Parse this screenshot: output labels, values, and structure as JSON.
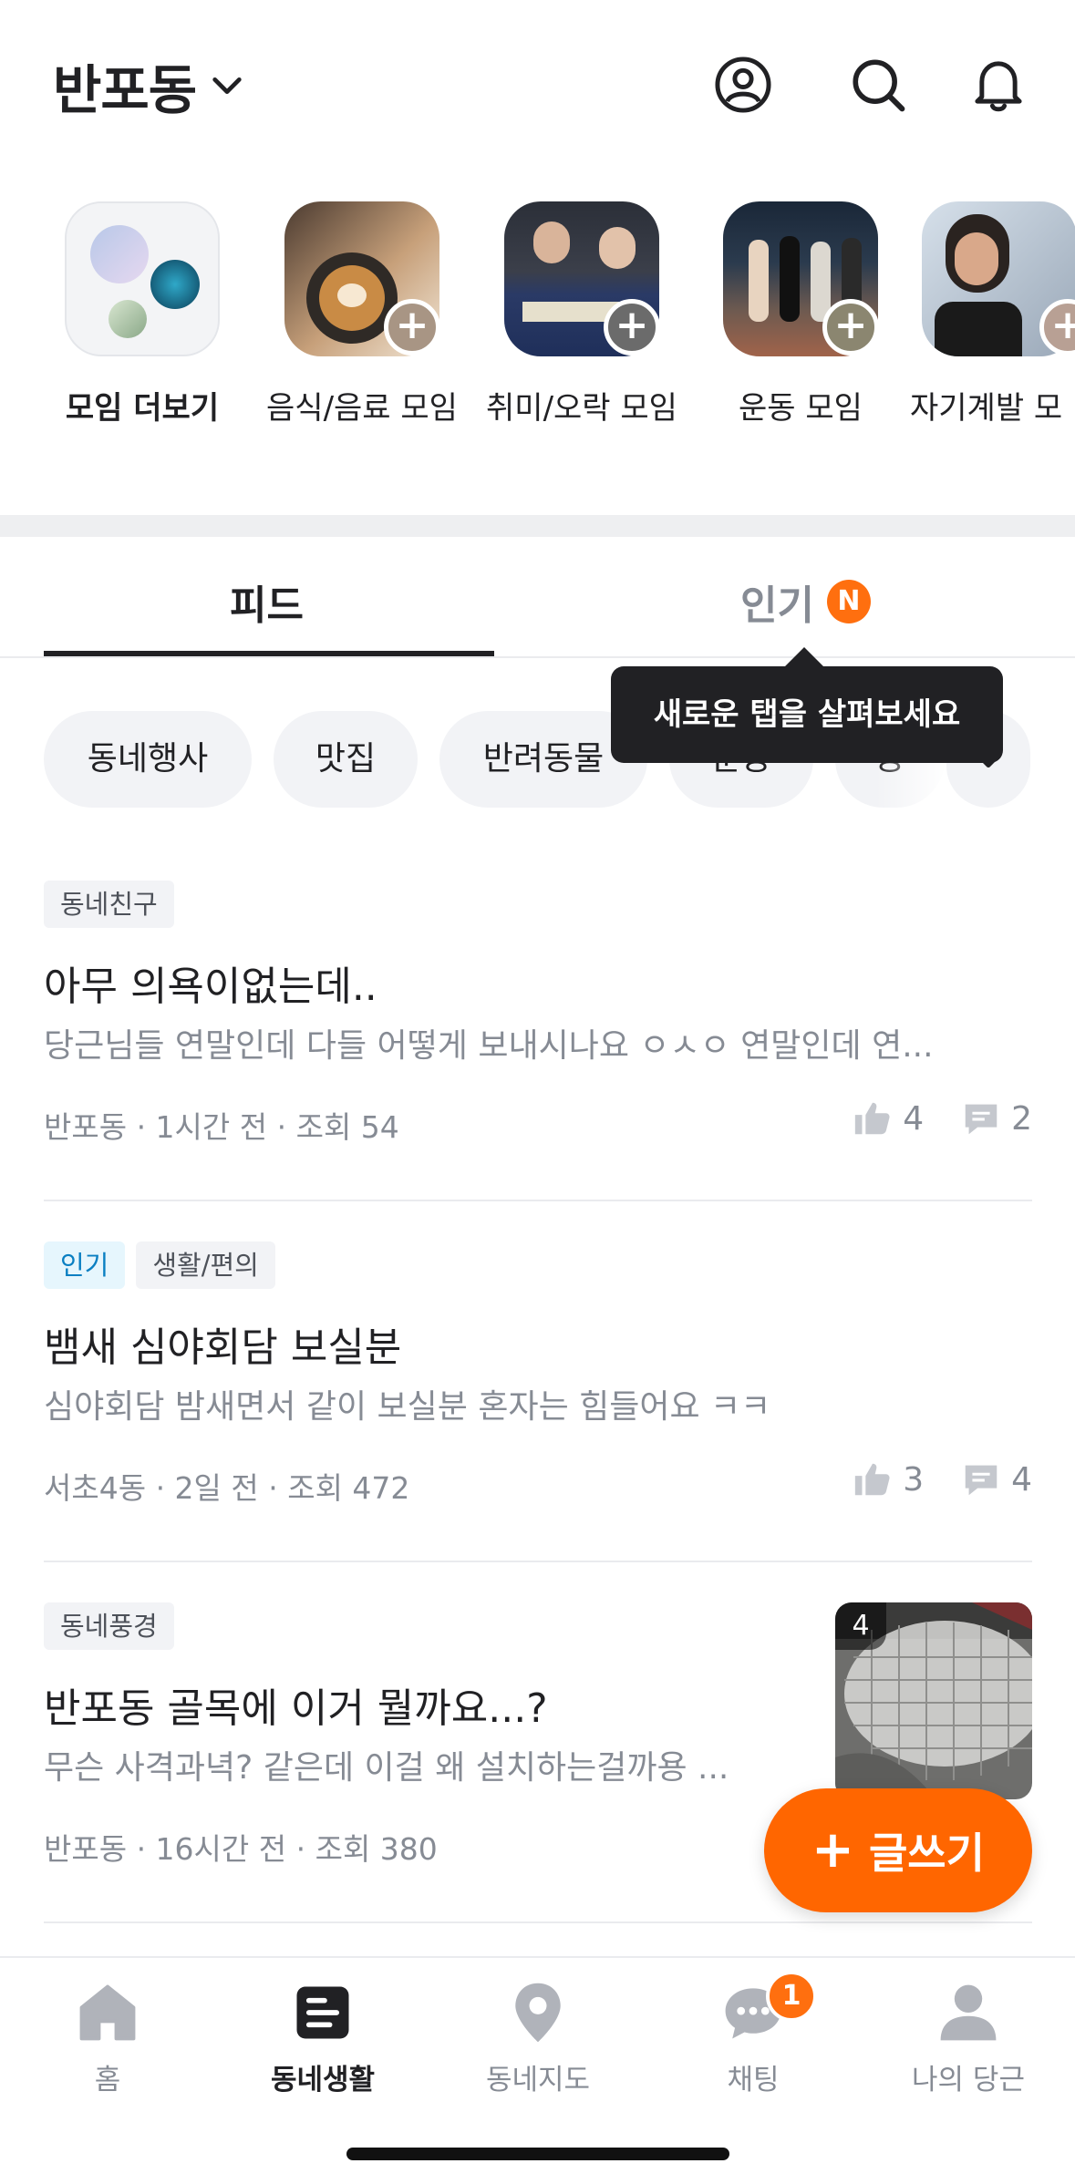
{
  "header": {
    "location": "반포동",
    "icons": [
      "profile-icon",
      "search-icon",
      "bell-icon"
    ]
  },
  "meetups": [
    {
      "label": "모임 더보기"
    },
    {
      "label": "음식/음료 모임"
    },
    {
      "label": "취미/오락 모임"
    },
    {
      "label": "운동 모임"
    },
    {
      "label": "자기계발 모"
    }
  ],
  "tabs": {
    "feed": "피드",
    "popular": "인기",
    "popular_badge": "N"
  },
  "tooltip": "새로운 탭을 살펴보세요",
  "chips": [
    "동네행사",
    "맛집",
    "반려동물",
    "운동",
    "공"
  ],
  "posts": [
    {
      "badges": [
        "동네친구"
      ],
      "title": "아무 의욕이없는데..",
      "body": "당근님들 연말인데 다들 어떻게 보내시나요 ㅇㅅㅇ 연말인데 연...",
      "meta": "반포동 · 1시간 전 · 조회 54",
      "likes": "4",
      "comments": "2"
    },
    {
      "hot_badge": "인기",
      "badges": [
        "생활/편의"
      ],
      "title": "뱀새 심야회담 보실분",
      "body": "심야회담 밤새면서 같이 보실분 혼자는 힘들어요 ㅋㅋ",
      "meta": "서초4동 · 2일 전 · 조회 472",
      "likes": "3",
      "comments": "4"
    },
    {
      "badges": [
        "동네풍경"
      ],
      "title": "반포동 골목에 이거 뭘까요...?",
      "body": "무슨 사격과녁? 같은데 이걸 왜 설치하는걸까용 ...",
      "meta": "반포동 · 16시간 전 · 조회 380",
      "image_count": "4"
    }
  ],
  "fab": {
    "plus": "+",
    "label": "글쓰기"
  },
  "nav": [
    {
      "label": "홈",
      "icon": "home-icon"
    },
    {
      "label": "동네생활",
      "icon": "community-icon"
    },
    {
      "label": "동네지도",
      "icon": "map-pin-icon"
    },
    {
      "label": "채팅",
      "icon": "chat-icon",
      "badge": "1"
    },
    {
      "label": "나의 당근",
      "icon": "person-icon"
    }
  ],
  "colors": {
    "accent": "#ff6f0f",
    "fab": "#ff6600",
    "text": "#212124",
    "muted": "#868b94"
  }
}
